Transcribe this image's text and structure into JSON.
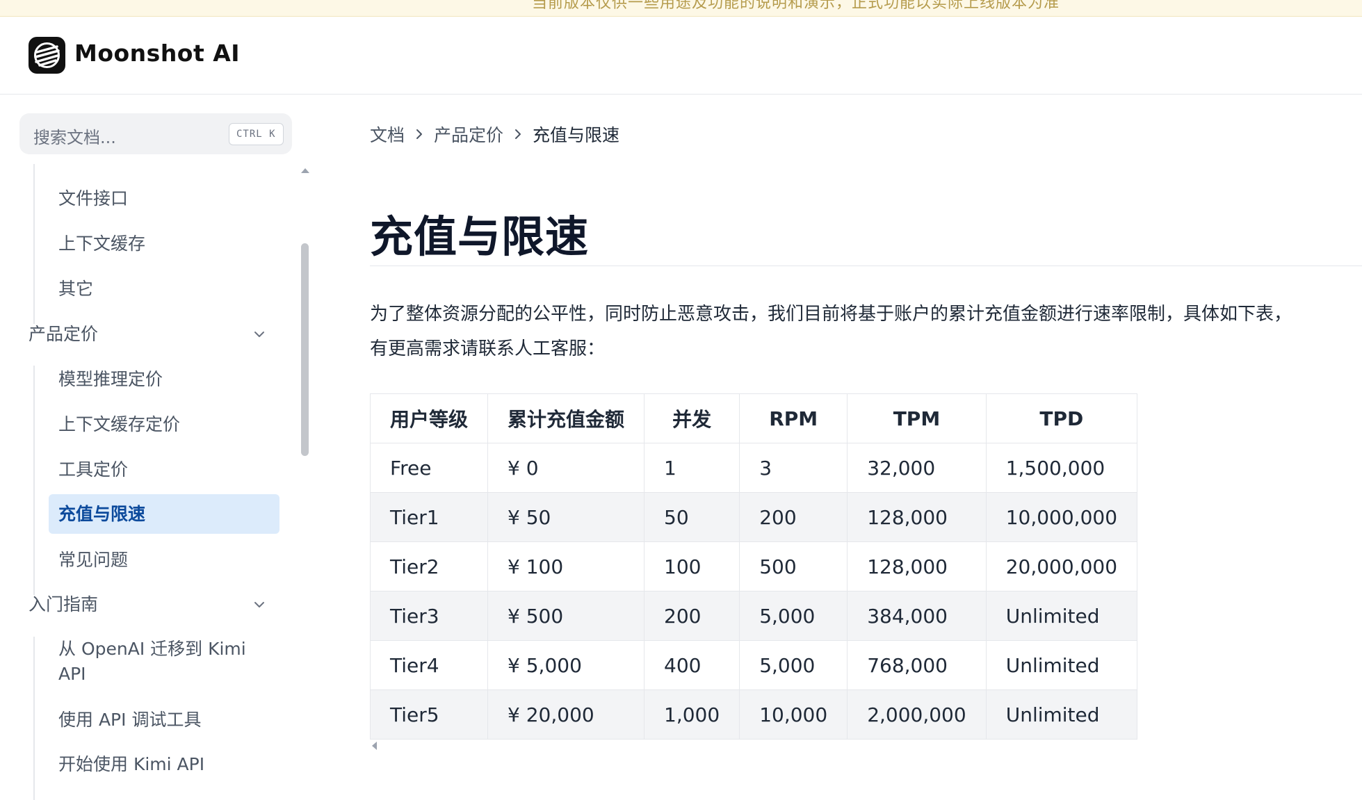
{
  "banner": {
    "text": "当前版本仅供一些用途及功能的说明和演示，正式功能以实际上线版本为准"
  },
  "header": {
    "brand": "Moonshot AI"
  },
  "search": {
    "placeholder": "搜索文档...",
    "shortcut": "CTRL K"
  },
  "sidebar": {
    "group1": [
      "文件接口",
      "上下文缓存",
      "其它"
    ],
    "pricing": {
      "label": "产品定价",
      "items": [
        "模型推理定价",
        "上下文缓存定价",
        "工具定价",
        "充值与限速",
        "常见问题"
      ],
      "active": "充值与限速"
    },
    "guide": {
      "label": "入门指南",
      "items": [
        "从 OpenAI 迁移到 Kimi",
        "API",
        "使用 API 调试工具",
        "开始使用 Kimi API"
      ]
    }
  },
  "breadcrumb": [
    "文档",
    "产品定价",
    "充值与限速"
  ],
  "page": {
    "title": "充值与限速",
    "intro_line1": "为了整体资源分配的公平性，同时防止恶意攻击，我们目前将基于账户的累计充值金额进行速率限制，具体如下表，",
    "intro_line2": "有更高需求请联系人工客服："
  },
  "table": {
    "headers": [
      "用户等级",
      "累计充值金额",
      "并发",
      "RPM",
      "TPM",
      "TPD"
    ],
    "rows": [
      [
        "Free",
        "¥ 0",
        "1",
        "3",
        "32,000",
        "1,500,000"
      ],
      [
        "Tier1",
        "¥ 50",
        "50",
        "200",
        "128,000",
        "10,000,000"
      ],
      [
        "Tier2",
        "¥ 100",
        "100",
        "500",
        "128,000",
        "20,000,000"
      ],
      [
        "Tier3",
        "¥ 500",
        "200",
        "5,000",
        "384,000",
        "Unlimited"
      ],
      [
        "Tier4",
        "¥ 5,000",
        "400",
        "5,000",
        "768,000",
        "Unlimited"
      ],
      [
        "Tier5",
        "¥ 20,000",
        "1,000",
        "10,000",
        "2,000,000",
        "Unlimited"
      ]
    ]
  },
  "icons": {
    "logo": "moonshot-logo-icon",
    "chevron": "chevron-down-icon",
    "separator": "chevron-right-icon"
  },
  "colors": {
    "active_bg": "#dcebfb",
    "active_text": "#0c4a9c",
    "title": "#0f172a",
    "banner_bg": "#fdf8e6"
  }
}
